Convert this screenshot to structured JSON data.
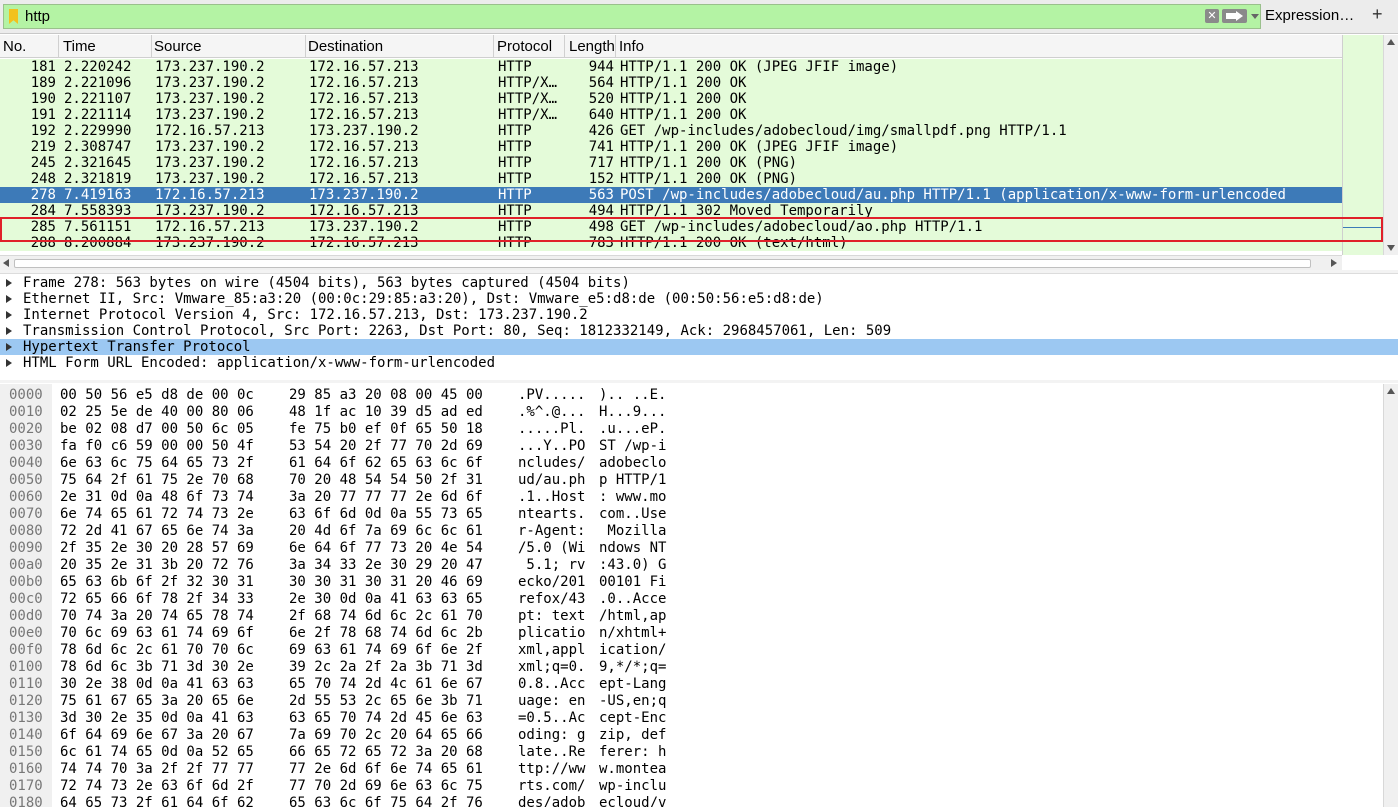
{
  "filter": {
    "value": "http",
    "expression_label": "Expression…",
    "add_label": "+",
    "clear_glyph": "✕"
  },
  "columns": [
    "No.",
    "Time",
    "Source",
    "Destination",
    "Protocol",
    "Length",
    "Info"
  ],
  "packets": [
    {
      "no": "181",
      "time": "2.220242",
      "src": "173.237.190.2",
      "dst": "172.16.57.213",
      "proto": "HTTP",
      "len": "944",
      "info": "HTTP/1.1 200 OK  (JPEG JFIF image)"
    },
    {
      "no": "189",
      "time": "2.221096",
      "src": "173.237.190.2",
      "dst": "172.16.57.213",
      "proto": "HTTP/X…",
      "len": "564",
      "info": "HTTP/1.1 200 OK"
    },
    {
      "no": "190",
      "time": "2.221107",
      "src": "173.237.190.2",
      "dst": "172.16.57.213",
      "proto": "HTTP/X…",
      "len": "520",
      "info": "HTTP/1.1 200 OK"
    },
    {
      "no": "191",
      "time": "2.221114",
      "src": "173.237.190.2",
      "dst": "172.16.57.213",
      "proto": "HTTP/X…",
      "len": "640",
      "info": "HTTP/1.1 200 OK"
    },
    {
      "no": "192",
      "time": "2.229990",
      "src": "172.16.57.213",
      "dst": "173.237.190.2",
      "proto": "HTTP",
      "len": "426",
      "info": "GET /wp-includes/adobecloud/img/smallpdf.png HTTP/1.1"
    },
    {
      "no": "219",
      "time": "2.308747",
      "src": "173.237.190.2",
      "dst": "172.16.57.213",
      "proto": "HTTP",
      "len": "741",
      "info": "HTTP/1.1 200 OK  (JPEG JFIF image)"
    },
    {
      "no": "245",
      "time": "2.321645",
      "src": "173.237.190.2",
      "dst": "172.16.57.213",
      "proto": "HTTP",
      "len": "717",
      "info": "HTTP/1.1 200 OK  (PNG)"
    },
    {
      "no": "248",
      "time": "2.321819",
      "src": "173.237.190.2",
      "dst": "172.16.57.213",
      "proto": "HTTP",
      "len": "152",
      "info": "HTTP/1.1 200 OK  (PNG)"
    },
    {
      "no": "278",
      "time": "7.419163",
      "src": "172.16.57.213",
      "dst": "173.237.190.2",
      "proto": "HTTP",
      "len": "563",
      "info": "POST /wp-includes/adobecloud/au.php HTTP/1.1  (application/x-www-form-urlencoded",
      "selected": true
    },
    {
      "no": "284",
      "time": "7.558393",
      "src": "173.237.190.2",
      "dst": "172.16.57.213",
      "proto": "HTTP",
      "len": "494",
      "info": "HTTP/1.1 302 Moved Temporarily"
    },
    {
      "no": "285",
      "time": "7.561151",
      "src": "172.16.57.213",
      "dst": "173.237.190.2",
      "proto": "HTTP",
      "len": "498",
      "info": "GET /wp-includes/adobecloud/ao.php HTTP/1.1"
    },
    {
      "no": "288",
      "time": "8.200884",
      "src": "173.237.190.2",
      "dst": "172.16.57.213",
      "proto": "HTTP",
      "len": "783",
      "info": "HTTP/1.1 200 OK  (text/html)"
    }
  ],
  "details": [
    {
      "text": "Frame 278: 563 bytes on wire (4504 bits), 563 bytes captured (4504 bits)"
    },
    {
      "text": "Ethernet II, Src: Vmware_85:a3:20 (00:0c:29:85:a3:20), Dst: Vmware_e5:d8:de (00:50:56:e5:d8:de)"
    },
    {
      "text": "Internet Protocol Version 4, Src: 172.16.57.213, Dst: 173.237.190.2"
    },
    {
      "text": "Transmission Control Protocol, Src Port: 2263, Dst Port: 80, Seq: 1812332149, Ack: 2968457061, Len: 509"
    },
    {
      "text": "Hypertext Transfer Protocol",
      "selected": true
    },
    {
      "text": "HTML Form URL Encoded: application/x-www-form-urlencoded"
    }
  ],
  "bytes": [
    {
      "offset": "0000",
      "hex1": "00 50 56 e5 d8 de 00 0c",
      "hex2": "29 85 a3 20 08 00 45 00",
      "ascii1": ".PV.....",
      "ascii2": ").. ..E."
    },
    {
      "offset": "0010",
      "hex1": "02 25 5e de 40 00 80 06",
      "hex2": "48 1f ac 10 39 d5 ad ed",
      "ascii1": ".%^.@...",
      "ascii2": "H...9..."
    },
    {
      "offset": "0020",
      "hex1": "be 02 08 d7 00 50 6c 05",
      "hex2": "fe 75 b0 ef 0f 65 50 18",
      "ascii1": ".....Pl.",
      "ascii2": ".u...eP."
    },
    {
      "offset": "0030",
      "hex1": "fa f0 c6 59 00 00 50 4f",
      "hex2": "53 54 20 2f 77 70 2d 69",
      "ascii1": "...Y..PO",
      "ascii2": "ST /wp-i"
    },
    {
      "offset": "0040",
      "hex1": "6e 63 6c 75 64 65 73 2f",
      "hex2": "61 64 6f 62 65 63 6c 6f",
      "ascii1": "ncludes/",
      "ascii2": "adobeclo"
    },
    {
      "offset": "0050",
      "hex1": "75 64 2f 61 75 2e 70 68",
      "hex2": "70 20 48 54 54 50 2f 31",
      "ascii1": "ud/au.ph",
      "ascii2": "p HTTP/1"
    },
    {
      "offset": "0060",
      "hex1": "2e 31 0d 0a 48 6f 73 74",
      "hex2": "3a 20 77 77 77 2e 6d 6f",
      "ascii1": ".1..Host",
      "ascii2": ": www.mo"
    },
    {
      "offset": "0070",
      "hex1": "6e 74 65 61 72 74 73 2e",
      "hex2": "63 6f 6d 0d 0a 55 73 65",
      "ascii1": "ntearts.",
      "ascii2": "com..Use"
    },
    {
      "offset": "0080",
      "hex1": "72 2d 41 67 65 6e 74 3a",
      "hex2": "20 4d 6f 7a 69 6c 6c 61",
      "ascii1": "r-Agent:",
      "ascii2": " Mozilla"
    },
    {
      "offset": "0090",
      "hex1": "2f 35 2e 30 20 28 57 69",
      "hex2": "6e 64 6f 77 73 20 4e 54",
      "ascii1": "/5.0 (Wi",
      "ascii2": "ndows NT"
    },
    {
      "offset": "00a0",
      "hex1": "20 35 2e 31 3b 20 72 76",
      "hex2": "3a 34 33 2e 30 29 20 47",
      "ascii1": " 5.1; rv",
      "ascii2": ":43.0) G"
    },
    {
      "offset": "00b0",
      "hex1": "65 63 6b 6f 2f 32 30 31",
      "hex2": "30 30 31 30 31 20 46 69",
      "ascii1": "ecko/201",
      "ascii2": "00101 Fi"
    },
    {
      "offset": "00c0",
      "hex1": "72 65 66 6f 78 2f 34 33",
      "hex2": "2e 30 0d 0a 41 63 63 65",
      "ascii1": "refox/43",
      "ascii2": ".0..Acce"
    },
    {
      "offset": "00d0",
      "hex1": "70 74 3a 20 74 65 78 74",
      "hex2": "2f 68 74 6d 6c 2c 61 70",
      "ascii1": "pt: text",
      "ascii2": "/html,ap"
    },
    {
      "offset": "00e0",
      "hex1": "70 6c 69 63 61 74 69 6f",
      "hex2": "6e 2f 78 68 74 6d 6c 2b",
      "ascii1": "plicatio",
      "ascii2": "n/xhtml+"
    },
    {
      "offset": "00f0",
      "hex1": "78 6d 6c 2c 61 70 70 6c",
      "hex2": "69 63 61 74 69 6f 6e 2f",
      "ascii1": "xml,appl",
      "ascii2": "ication/"
    },
    {
      "offset": "0100",
      "hex1": "78 6d 6c 3b 71 3d 30 2e",
      "hex2": "39 2c 2a 2f 2a 3b 71 3d",
      "ascii1": "xml;q=0.",
      "ascii2": "9,*/*;q="
    },
    {
      "offset": "0110",
      "hex1": "30 2e 38 0d 0a 41 63 63",
      "hex2": "65 70 74 2d 4c 61 6e 67",
      "ascii1": "0.8..Acc",
      "ascii2": "ept-Lang"
    },
    {
      "offset": "0120",
      "hex1": "75 61 67 65 3a 20 65 6e",
      "hex2": "2d 55 53 2c 65 6e 3b 71",
      "ascii1": "uage: en",
      "ascii2": "-US,en;q"
    },
    {
      "offset": "0130",
      "hex1": "3d 30 2e 35 0d 0a 41 63",
      "hex2": "63 65 70 74 2d 45 6e 63",
      "ascii1": "=0.5..Ac",
      "ascii2": "cept-Enc"
    },
    {
      "offset": "0140",
      "hex1": "6f 64 69 6e 67 3a 20 67",
      "hex2": "7a 69 70 2c 20 64 65 66",
      "ascii1": "oding: g",
      "ascii2": "zip, def"
    },
    {
      "offset": "0150",
      "hex1": "6c 61 74 65 0d 0a 52 65",
      "hex2": "66 65 72 65 72 3a 20 68",
      "ascii1": "late..Re",
      "ascii2": "ferer: h"
    },
    {
      "offset": "0160",
      "hex1": "74 74 70 3a 2f 2f 77 77",
      "hex2": "77 2e 6d 6f 6e 74 65 61",
      "ascii1": "ttp://ww",
      "ascii2": "w.montea"
    },
    {
      "offset": "0170",
      "hex1": "72 74 73 2e 63 6f 6d 2f",
      "hex2": "77 70 2d 69 6e 63 6c 75",
      "ascii1": "rts.com/",
      "ascii2": "wp-inclu"
    },
    {
      "offset": "0180",
      "hex1": "64 65 73 2f 61 64 6f 62",
      "hex2": "65 63 6c 6f 75 64 2f 76",
      "ascii1": "des/adob",
      "ascii2": "ecloud/v"
    }
  ],
  "colors": {
    "filter_valid": "#b4f3a4",
    "row_http": "#e4fbd9",
    "row_selected": "#3d7ab8",
    "detail_selected": "#9cc8f2",
    "highlight_box": "#e0202a"
  }
}
